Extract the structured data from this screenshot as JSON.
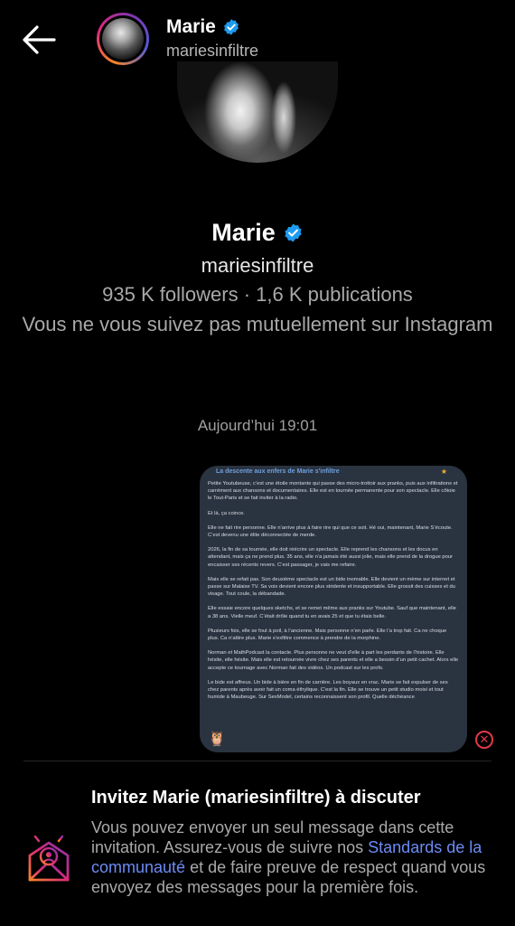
{
  "header": {
    "name": "Marie",
    "handle": "mariesinfiltre"
  },
  "profile": {
    "name": "Marie",
    "handle": "mariesinfiltre",
    "stats": "935 K followers · 1,6 K publications",
    "note": "Vous ne vous suivez pas mutuellement sur Instagram"
  },
  "timestamp": "Aujourd’hui 19:01",
  "message_image": {
    "title": "La descente aux enfers de Marie s'infiltre",
    "paragraphs": [
      "Petite Youtubeuse, c’est une étoile montante qui passe des micro-trottoir aux pranks, puis aux infiltrations et carrément aux chansons et documentaires. Elle est en tournée permanente pour son spectacle. Elle côtoie le Tout-Paris et se fait inviter à la radio.",
      "Et là, ça coince.",
      "Elle ne fait rire personne. Elle n’arrive plus à faire rire qui que ce soit. Hé oui, maintenant, Marie S’écoute. C’est devenu une élite déconnectée de merde.",
      "2026, la fin de sa tournée, elle doit réécrire un spectacle. Elle reprend les chansons et les docus en attendant, mais ça ne prend plus. 35 ans, elle n’a jamais été aussi jolie, mais elle prend de la drogue pour encaisser ses récents revers. C’est passager, je vais me refaire.",
      "Mais elle se refait pas. Son deuxième spectacle est un bide inomable. Elle devient un mème sur internet et passe sur Malaise TV. Sa voix devient encore plus stridente et insupportable. Elle grossit des cuisses et du visage. Tout coule, la débandade.",
      "Elle essaie encore quelques sketchs, et se remet même aux pranks sur Youtube. Sauf que maintenant, elle a 38 ans. Vielle meuf. C’était drôle quand tu en avais 25 et que tu étais belle.",
      "Plusieurs fois, elle se fout à poil, à l’ancienne. Mais personne n’en parle. Elle l’a trop fait. Ca ne choque plus. Ca n’attire plus. Marie s’exfiltre commence à prendre de la morphine.",
      "Norman et MathPodcast la contacte. Plus personne ne veut d’elle à part les perdants de l’histoire. Elle hésite, elle hésite. Mais elle est retournée vivre chez ses parents et elle a besoin d’un petit cachet. Alors elle accepte ce tournage avec Norman fait des vidéos. Un podcast sur les profs.",
      "Le bide est affreux. Un bide à bière en fin de carrière. Les boyaux en vrac. Marie se fait expulser de ses chez parents après avoir fait un coma éthylique. C’est la fin. Elle se trouve un petit studio moisi et tout humide à Maubeuge. Sur SexModel, certains reconnaissent son profil. Quelle déchéance"
    ]
  },
  "invite": {
    "title": "Invitez Marie (mariesinfiltre) à discuter",
    "text_before": "Vous pouvez envoyer un seul message dans cette invitation. Assurez-vous de suivre nos ",
    "link": "Standards de la communauté",
    "text_after": " et de faire preuve de respect quand vous envoyez des messages pour la première fois."
  },
  "icons": {
    "back": "arrow-left-icon",
    "verified": "verified-badge-icon",
    "remove": "close-circle-icon",
    "invite": "envelope-user-icon"
  },
  "colors": {
    "background": "#000000",
    "verified": "#1d9bf0",
    "link": "#6c8cf5",
    "remove": "#e0394c"
  }
}
